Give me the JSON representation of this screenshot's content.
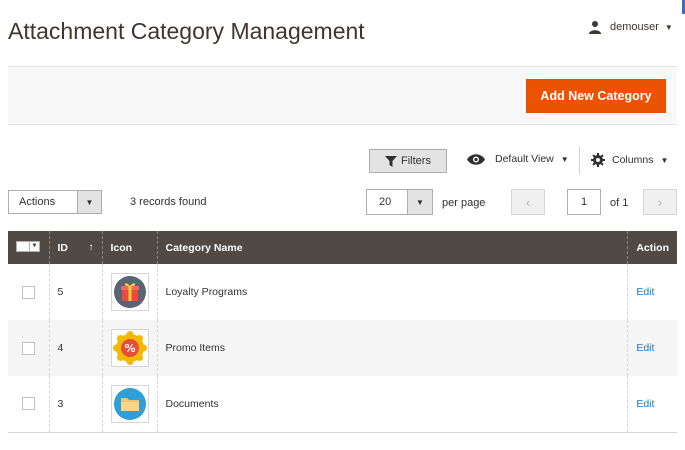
{
  "header": {
    "title": "Attachment Category Management",
    "username": "demouser"
  },
  "action_bar": {
    "add_button_label": "Add New Category"
  },
  "toolbar": {
    "filters_label": "Filters",
    "view_label": "Default View",
    "columns_label": "Columns",
    "actions_label": "Actions",
    "records_found": "3 records found",
    "per_page_value": "20",
    "per_page_label": "per page",
    "current_page": "1",
    "page_of": "of 1"
  },
  "grid": {
    "columns": [
      "ID",
      "Icon",
      "Category Name",
      "Action"
    ],
    "rows": [
      {
        "id": "5",
        "name": "Loyalty Programs",
        "icon": "gift-icon",
        "action": "Edit"
      },
      {
        "id": "4",
        "name": "Promo Items",
        "icon": "percent-badge-icon",
        "action": "Edit"
      },
      {
        "id": "3",
        "name": "Documents",
        "icon": "folder-icon",
        "action": "Edit"
      }
    ]
  },
  "colors": {
    "accent": "#eb5202",
    "grid_header": "#514943",
    "link": "#1979c3"
  }
}
